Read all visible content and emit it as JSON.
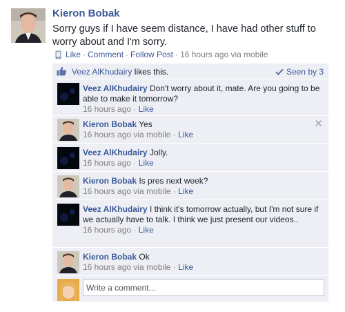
{
  "post": {
    "author": "Kieron Bobak",
    "text": "Sorry guys if I have seem distance, I have had other stuff to worry about and I'm sorry.",
    "actions": {
      "like": "Like",
      "comment": "Comment",
      "follow": "Follow Post"
    },
    "separator": "·",
    "timestamp": "16 hours ago via mobile"
  },
  "likes": {
    "liker": "Veez AlKhudairy",
    "likes_text": "likes this.",
    "seen_by": "Seen by 3"
  },
  "comments": [
    {
      "author": "Veez AlKhudairy",
      "text": "Don't worry about it, mate. Are you going to be able to make it tomorrow?",
      "time": "16 hours ago",
      "like": "Like"
    },
    {
      "author": "Kieron Bobak",
      "text": "Yes",
      "time": "16 hours ago via mobile",
      "like": "Like"
    },
    {
      "author": "Veez AlKhudairy",
      "text": "Jolly.",
      "time": "16 hours ago",
      "like": "Like"
    },
    {
      "author": "Kieron Bobak",
      "text": "Is pres next week?",
      "time": "16 hours ago via mobile",
      "like": "Like"
    },
    {
      "author": "Veez AlKhudairy",
      "text": "I think it's tomorrow actually, but I'm not sure if we actually have to talk. I think we just present our videos..",
      "time": "16 hours ago",
      "like": "Like"
    },
    {
      "author": "Kieron Bobak",
      "text": "Ok",
      "time": "16 hours ago via mobile",
      "like": "Like"
    }
  ],
  "composer": {
    "placeholder": "Write a comment..."
  },
  "icons": {
    "mobile": "mobile-phone-icon",
    "thumb": "thumbs-up-icon",
    "seen": "checkmark-icon",
    "close": "close-icon"
  },
  "colors": {
    "link": "#3b5998",
    "panel": "#edeff4",
    "muted": "#808080"
  }
}
